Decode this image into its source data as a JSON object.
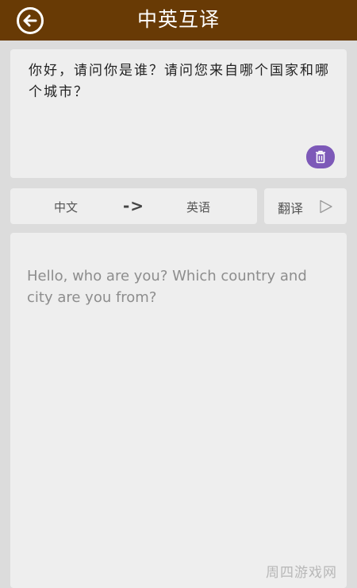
{
  "header": {
    "title": "中英互译",
    "back_icon": "back-arrow-circle-icon"
  },
  "input": {
    "text": "你好，请问你是谁？请问您来自哪个国家和哪个城市？",
    "delete_icon": "trash-icon"
  },
  "language": {
    "source": "中文",
    "arrow": "->",
    "target": "英语"
  },
  "translate": {
    "label": "翻译",
    "icon": "play-icon"
  },
  "output": {
    "text": "Hello, who are you? Which country and city are you from?"
  },
  "watermark": "周四游戏网",
  "colors": {
    "header_bg": "#683a05",
    "accent": "#7d59b8",
    "card_bg": "#eeeeee",
    "page_bg": "#dcdcdc"
  }
}
